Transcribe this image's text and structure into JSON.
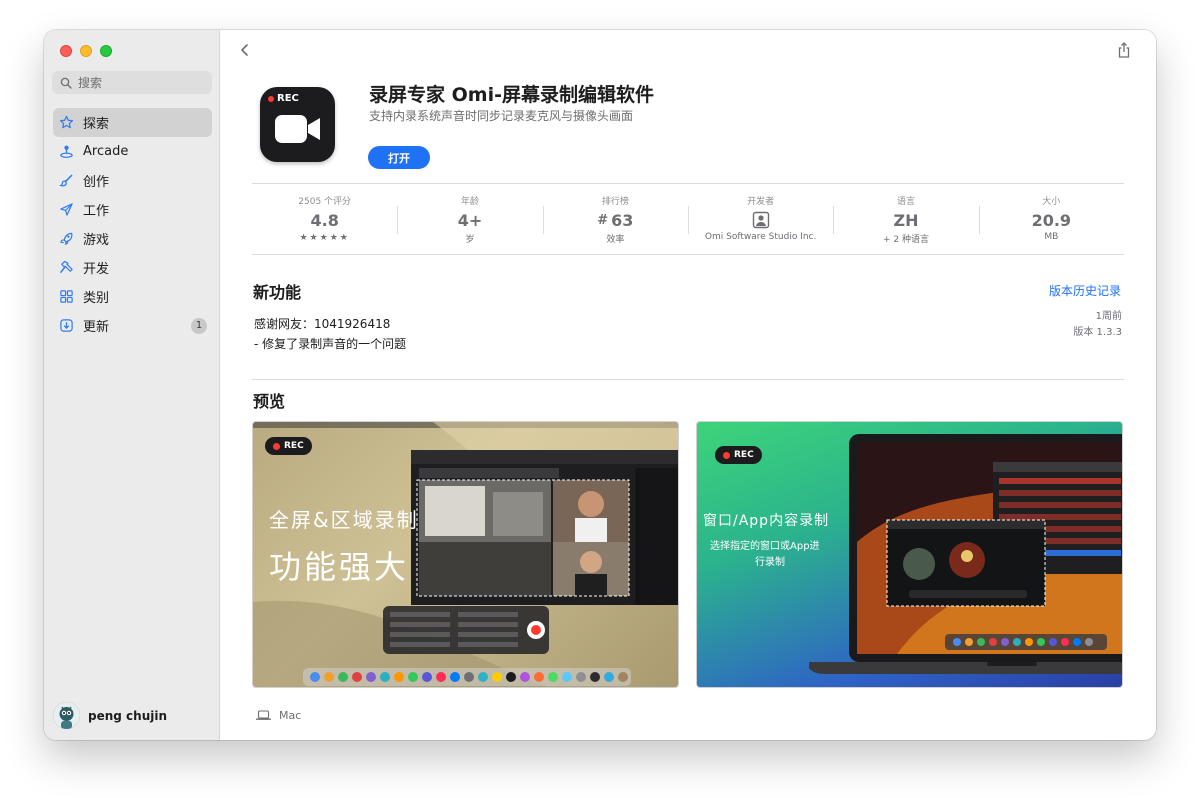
{
  "window": {
    "controls": [
      "close",
      "minimize",
      "zoom"
    ]
  },
  "sidebar": {
    "search_placeholder": "搜索",
    "items": [
      {
        "label": "探索",
        "icon": "star-icon",
        "active": true
      },
      {
        "label": "Arcade",
        "icon": "joystick-icon"
      },
      {
        "label": "创作",
        "icon": "brush-icon"
      },
      {
        "label": "工作",
        "icon": "paper-plane-icon"
      },
      {
        "label": "游戏",
        "icon": "rocket-icon"
      },
      {
        "label": "开发",
        "icon": "hammer-icon"
      },
      {
        "label": "类别",
        "icon": "grid-icon"
      },
      {
        "label": "更新",
        "icon": "download-icon",
        "badge": "1"
      }
    ],
    "user": {
      "name": "peng chujin"
    }
  },
  "app": {
    "icon_label": "REC",
    "title": "录屏专家 Omi-屏幕录制编辑软件",
    "subtitle": "支持内录系统声音时同步记录麦克风与摄像头画面",
    "open_label": "打开"
  },
  "stats": [
    {
      "label": "2505 个评分",
      "value": "4.8",
      "sub": "★★★★★"
    },
    {
      "label": "年龄",
      "value": "4+",
      "sub": "岁"
    },
    {
      "label": "排行榜",
      "hash": "#",
      "value": "63",
      "sub": "效率"
    },
    {
      "label": "开发者",
      "value": "",
      "sub": "Omi Software Studio Inc."
    },
    {
      "label": "语言",
      "value": "ZH",
      "sub": "+ 2 种语言"
    },
    {
      "label": "大小",
      "value": "20.9",
      "sub": "MB"
    }
  ],
  "whats_new": {
    "title": "新功能",
    "history_link": "版本历史记录",
    "notes": [
      "感谢网友：1041926418",
      "- 修复了录制声音的一个问题"
    ],
    "time_ago": "1周前",
    "version": "版本 1.3.3"
  },
  "preview": {
    "title": "预览",
    "shots": [
      {
        "badge": "REC",
        "line1": "全屏&区域录制",
        "line2": "功能强大"
      },
      {
        "badge": "REC",
        "line1": "窗口/App内容录制",
        "line2": "选择指定的窗口或App进",
        "line3": "行录制"
      }
    ],
    "platform": "Mac"
  },
  "colors": {
    "accent": "#1f71f5",
    "sidebar_bg": "#ebebeb",
    "rec_red": "#ff3b30"
  }
}
